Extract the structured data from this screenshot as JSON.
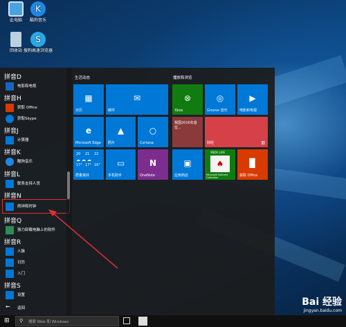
{
  "desktop": {
    "icons": [
      {
        "label": "此电脑",
        "icon": "computer-icon"
      },
      {
        "label": "酷狗音乐",
        "icon": "kugou-icon"
      },
      {
        "label": "回收站",
        "icon": "recycle-bin-icon"
      },
      {
        "label": "搜狗高速浏览器",
        "icon": "sogou-browser-icon"
      }
    ]
  },
  "start_menu": {
    "app_list": [
      {
        "kind": "header",
        "label": "拼音D"
      },
      {
        "kind": "app",
        "label": "电影和电视"
      },
      {
        "kind": "header",
        "label": "拼音H"
      },
      {
        "kind": "app",
        "label": "获取 Office"
      },
      {
        "kind": "app",
        "label": "获取Skype"
      },
      {
        "kind": "header",
        "label": "拼音J"
      },
      {
        "kind": "app",
        "label": "计算器"
      },
      {
        "kind": "header",
        "label": "拼音K"
      },
      {
        "kind": "app",
        "label": "酷狗音乐"
      },
      {
        "kind": "header",
        "label": "拼音L"
      },
      {
        "kind": "app",
        "label": "联系支持人员"
      },
      {
        "kind": "header",
        "label": "拼音N"
      },
      {
        "kind": "app",
        "label": "闹钟和时钟"
      },
      {
        "kind": "header",
        "label": "拼音Q"
      },
      {
        "kind": "app",
        "label": "强力卸载电脑上的软件"
      },
      {
        "kind": "header",
        "label": "拼音R"
      },
      {
        "kind": "app",
        "label": "人脉"
      },
      {
        "kind": "app",
        "label": "日历"
      },
      {
        "kind": "app",
        "label": "入门"
      },
      {
        "kind": "header",
        "label": "拼音S"
      },
      {
        "kind": "app",
        "label": "设置"
      }
    ],
    "back_label": "返回",
    "groups": {
      "left_title": "生活动态",
      "right_title": "播放和浏览"
    },
    "tiles": {
      "calendar": "日历",
      "mail": "邮件",
      "edge": "Microsoft Edge",
      "photos": "照片",
      "cortana": "Cortana",
      "weather_label": "质量良好",
      "weather_days": [
        {
          "day": "20",
          "temp": "17°"
        },
        {
          "day": "21",
          "temp": "17°"
        },
        {
          "day": "22",
          "temp": "16°"
        }
      ],
      "phone": "手机助手",
      "onenote": "OneNote",
      "xbox": "Xbox",
      "groove": "Groove 音乐",
      "movies": "电影和电视",
      "news": "我国2016年首位...",
      "finance": "财经",
      "store": "应用商店",
      "solitaire": "Microsoft Solitaire Collection",
      "solitaire_badge": "XBOX LIVE",
      "office": "获取 Office"
    }
  },
  "taskbar": {
    "search_placeholder": "搜索 Web 和 Windows"
  },
  "watermark": {
    "logo": "Bai 经验",
    "url": "jingyan.baidu.com"
  },
  "colors": {
    "tile_blue": "#0078d7",
    "xbox_green": "#107c10",
    "news_red": "#c8353a",
    "finance_red": "#d64048",
    "onenote_purple": "#7d2d8f",
    "office_orange": "#d83b01",
    "highlight_red": "#e03030"
  }
}
